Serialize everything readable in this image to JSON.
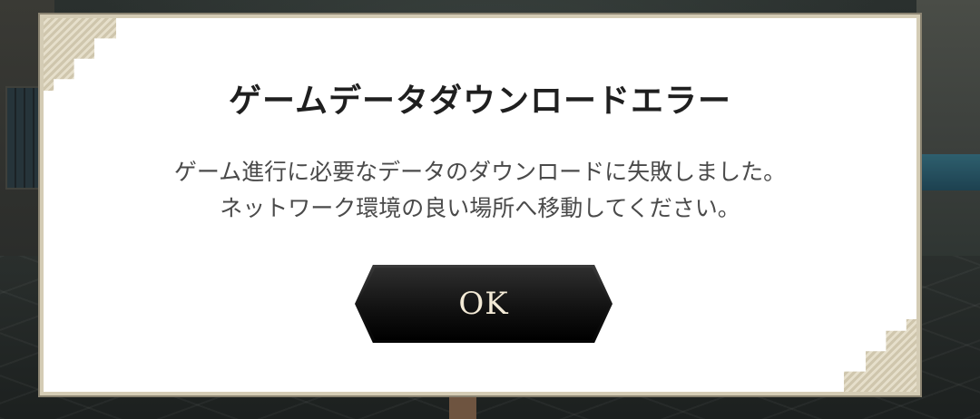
{
  "dialog": {
    "title": "ゲームデータダウンロードエラー",
    "message_lines": [
      "ゲーム進行に必要なデータのダウンロードに失敗しました。",
      "ネットワーク環境の良い場所へ移動してください。"
    ],
    "ok_button_label": "OK"
  },
  "colors": {
    "dialog_background": "#ffffff",
    "dialog_border": "#d4ccb5",
    "title_text": "#1f1f1f",
    "message_text": "#4a4a4a",
    "button_background": "#111111",
    "button_text": "#f3ead6"
  }
}
